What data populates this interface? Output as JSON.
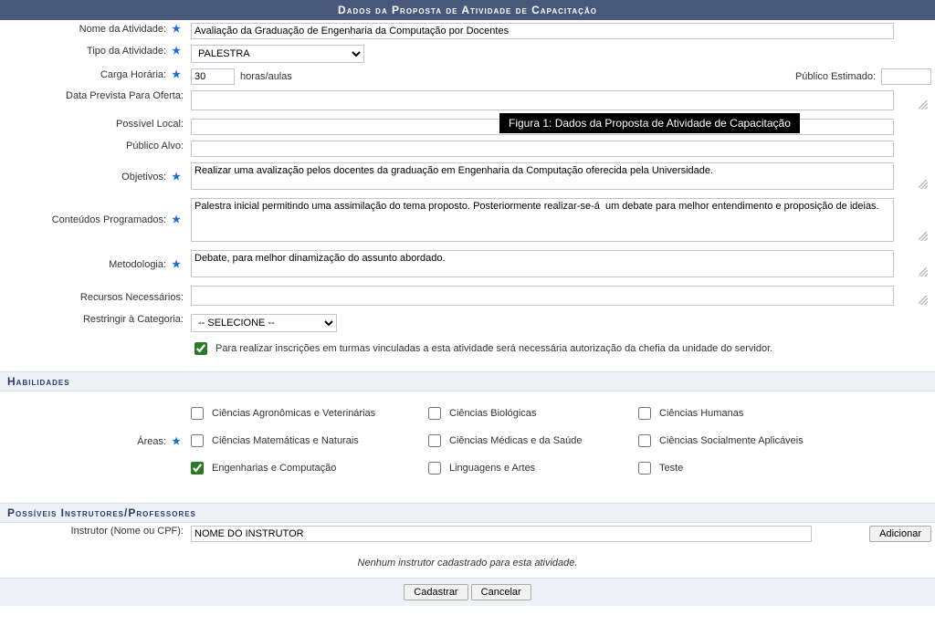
{
  "header": {
    "title": "Dados da Proposta de Atividade de Capacitação"
  },
  "tooltip": "Figura 1: Dados da Proposta de Atividade de Capacitação",
  "labels": {
    "nome_atividade": "Nome da Atividade:",
    "tipo_atividade": "Tipo da Atividade:",
    "carga_horaria": "Carga Horária:",
    "horas_aulas": "horas/aulas",
    "publico_estimado": "Público Estimado:",
    "data_prevista": "Data Prevista Para Oferta:",
    "possivel_local": "Possível Local:",
    "publico_alvo": "Público Alvo:",
    "objetivos": "Objetivos:",
    "conteudos": "Conteúdos Programados:",
    "metodologia": "Metodologia:",
    "recursos": "Recursos Necessários:",
    "restringir": "Restringir à Categoria:",
    "autorizacao": "Para realizar inscrições em turmas vinculadas a esta atividade será necessária autorização da chefia da unidade do servidor.",
    "areas": "Áreas:",
    "instrutor": "Instrutor (Nome ou CPF):"
  },
  "values": {
    "nome_atividade": "Avaliação da Graduação de Engenharia da Computação por Docentes",
    "tipo_atividade": "PALESTRA",
    "carga_horaria": "30",
    "publico_estimado": "",
    "data_prevista": "",
    "possivel_local": "",
    "publico_alvo": "",
    "objetivos": "Realizar uma avalização pelos docentes da graduação em Engenharia da Computação oferecida pela Universidade.",
    "conteudos": "Palestra inicial permitindo uma assimilação do tema proposto. Posteriormente realizar-se-á  um debate para melhor entendimento e proposição de ideias.",
    "metodologia": "Debate, para melhor dinamização do assunto abordado.",
    "recursos": "",
    "restringir": "-- SELECIONE --",
    "autorizacao_checked": true,
    "instrutor": "NOME DO INSTRUTOR"
  },
  "sections": {
    "habilidades": "Habilidades",
    "instrutores": "Possíveis Instrutores/Professores"
  },
  "areas": [
    {
      "label": "Ciências Agronômicas e Veterinárias",
      "checked": false
    },
    {
      "label": "Ciências Biológicas",
      "checked": false
    },
    {
      "label": "Ciências Humanas",
      "checked": false
    },
    {
      "label": "Ciências Matemáticas e Naturais",
      "checked": false
    },
    {
      "label": "Ciências Médicas e da Saúde",
      "checked": false
    },
    {
      "label": "Ciências Socialmente Aplicáveis",
      "checked": false
    },
    {
      "label": "Engenharias e Computação",
      "checked": true
    },
    {
      "label": "Linguagens e Artes",
      "checked": false
    },
    {
      "label": "Teste",
      "checked": false
    }
  ],
  "buttons": {
    "adicionar": "Adicionar",
    "cadastrar": "Cadastrar",
    "cancelar": "Cancelar"
  },
  "messages": {
    "no_instrutor": "Nenhum instrutor cadastrado para esta atividade."
  }
}
